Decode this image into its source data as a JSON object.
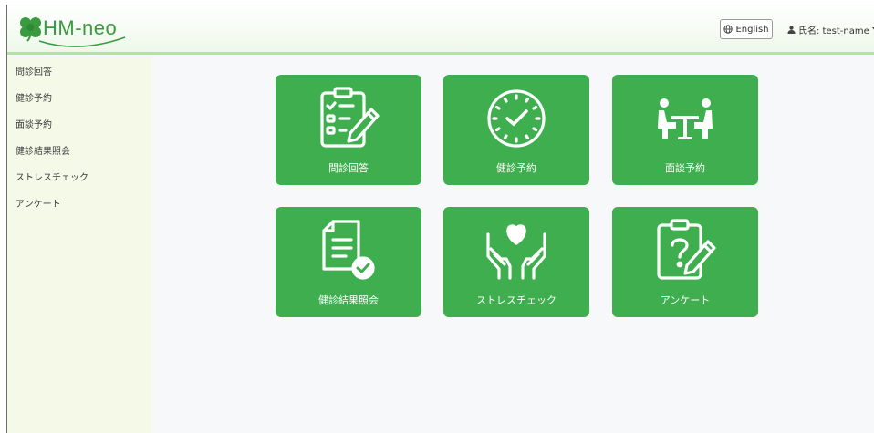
{
  "app": {
    "logo_text": "HM-neo"
  },
  "header": {
    "language_button": "English",
    "user_menu": "氏名: test-name"
  },
  "sidebar": {
    "items": [
      {
        "label": "問診回答"
      },
      {
        "label": "健診予約"
      },
      {
        "label": "面談予約"
      },
      {
        "label": "健診結果照会"
      },
      {
        "label": "ストレスチェック"
      },
      {
        "label": "アンケート"
      }
    ]
  },
  "tiles": [
    {
      "label": "問診回答",
      "icon": "questionnaire-checklist-icon"
    },
    {
      "label": "健診予約",
      "icon": "clock-icon"
    },
    {
      "label": "面談予約",
      "icon": "meeting-icon"
    },
    {
      "label": "健診結果照会",
      "icon": "document-check-icon"
    },
    {
      "label": "ストレスチェック",
      "icon": "heart-hands-icon"
    },
    {
      "label": "アンケート",
      "icon": "survey-clipboard-icon"
    }
  ],
  "colors": {
    "tile_green": "#3fae4f",
    "header_accent": "#b6e39b",
    "sidebar_bg": "#f5f9e7"
  }
}
